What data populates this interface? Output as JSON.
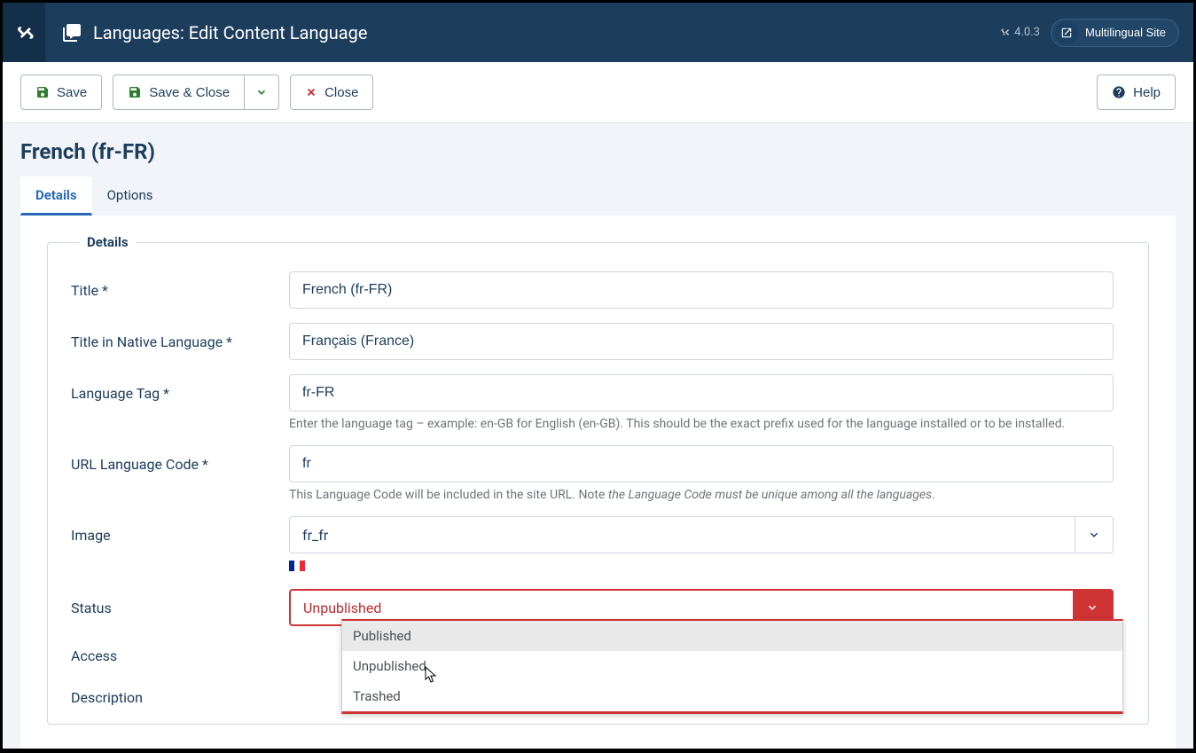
{
  "header": {
    "title": "Languages: Edit Content Language",
    "version": "4.0.3",
    "site_name": "Multilingual Site"
  },
  "toolbar": {
    "save": "Save",
    "save_close": "Save & Close",
    "close": "Close",
    "help": "Help"
  },
  "page": {
    "title": "French (fr-FR)"
  },
  "tabs": [
    {
      "label": "Details",
      "active": true
    },
    {
      "label": "Options",
      "active": false
    }
  ],
  "fieldset": {
    "legend": "Details"
  },
  "fields": {
    "title": {
      "label": "Title *",
      "value": "French (fr-FR)"
    },
    "native": {
      "label": "Title in Native Language *",
      "value": "Français (France)"
    },
    "tag": {
      "label": "Language Tag *",
      "value": "fr-FR",
      "help": "Enter the language tag – example: en-GB for English (en-GB). This should be the exact prefix used for the language installed or to be installed."
    },
    "urlcode": {
      "label": "URL Language Code *",
      "value": "fr",
      "help_plain": "This Language Code will be included in the site URL. Note ",
      "help_em": "the Language Code must be unique among all the languages"
    },
    "image": {
      "label": "Image",
      "value": "fr_fr"
    },
    "status": {
      "label": "Status",
      "value": "Unpublished",
      "options": [
        "Published",
        "Unpublished",
        "Trashed"
      ]
    },
    "access": {
      "label": "Access"
    },
    "description": {
      "label": "Description"
    }
  }
}
